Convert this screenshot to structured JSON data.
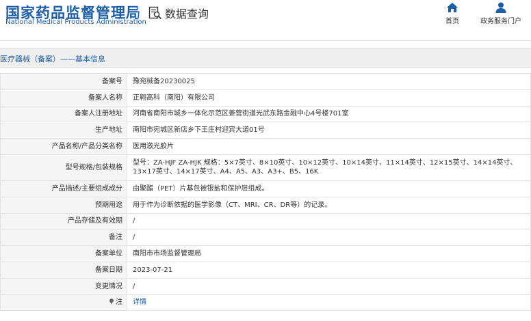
{
  "header": {
    "logo_cn": "国家药品监督管理局",
    "logo_en": "National Medical Products Administration",
    "query_title": "数据查询",
    "nav": [
      {
        "label": "首页",
        "icon": "home-icon"
      },
      {
        "label": "政务服务门户",
        "icon": "user-icon"
      }
    ]
  },
  "section": {
    "title": "医疗器械（备案）——基本信息"
  },
  "rows": [
    {
      "label": "备案号",
      "value": "豫宛械备20230025"
    },
    {
      "label": "备案人名称",
      "value": "正翱高科（南阳）有限公司"
    },
    {
      "label": "备案人注册地址",
      "value": "河南省南阳市城乡一体化示范区姜营街道光武东路金融中心4号楼701室"
    },
    {
      "label": "生产地址",
      "value": "南阳市宛城区新店乡下王庄村迎宾大道01号"
    },
    {
      "label": "产品名称/产品分类名称",
      "value": "医用激光胶片"
    },
    {
      "label": "型号规格/包装规格",
      "value": "型号：ZA-HJF ZA-HJK 规格：5×7英寸、8×10英寸、10×12英寸、10×14英寸、11×14英寸、12×15英寸、14×14英寸、13×17英寸、14×17英寸、A4、A5、A3、A3+、B5、16K"
    },
    {
      "label": "产品描述/主要组成成分",
      "value": "由聚酯（PET）片基包被银盐和保护层组成。"
    },
    {
      "label": "预期用途",
      "value": "用于作为诊断依据的医学影像（CT、MRI、CR、DR等）的记录。"
    },
    {
      "label": "产品存储及有效期",
      "value": "/"
    },
    {
      "label": "备注",
      "value": "/"
    },
    {
      "label": "备案单位",
      "value": "南阳市市场监督管理局"
    },
    {
      "label": "备案日期",
      "value": "2023-07-21"
    },
    {
      "label": "变更情况",
      "value": "/"
    },
    {
      "label": "注",
      "value": "详情",
      "icon": "pin-icon"
    }
  ],
  "colors": {
    "brand_blue": "#1b5eaa",
    "label_bg": "#f5f5f5",
    "section_bg": "#efefef",
    "border": "#e2e2e2"
  }
}
